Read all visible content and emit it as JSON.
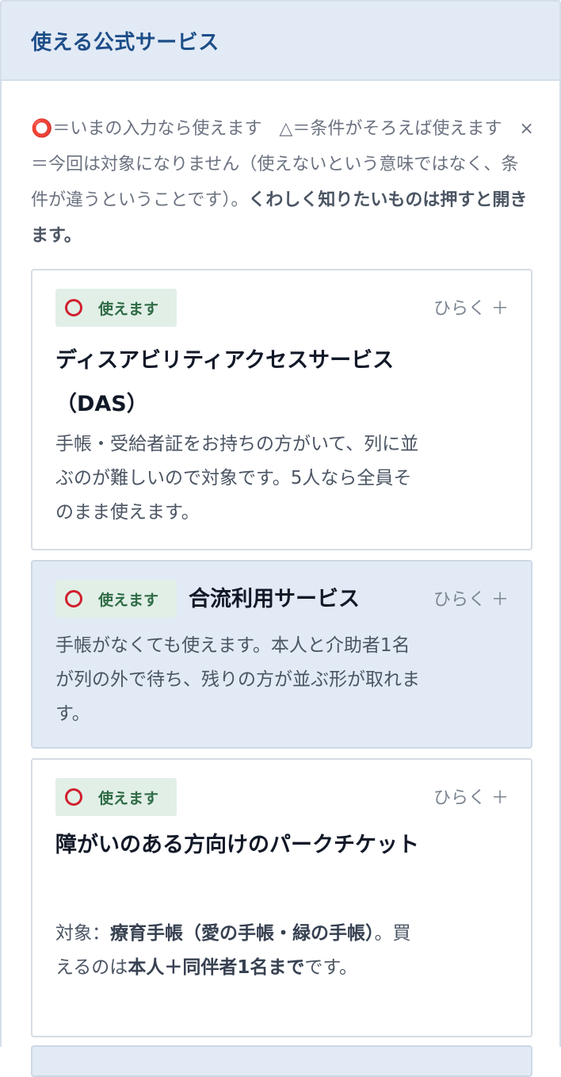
{
  "panel": {
    "title": "使える公式サービス"
  },
  "legend": {
    "ok_mark": "⭕",
    "text": "＝いまの入力なら使えます　△＝条件がそろえば使えます　×＝今回は対象になりません（使えないという意味ではなく、条件が違うということです）。",
    "bold": "くわしく知りたいものは押すと開きます。"
  },
  "cards": [
    {
      "status": "使えます",
      "status_mark": "circle-ok-icon",
      "toggle": "ひらく ＋",
      "title": "ディスアビリティアクセスサービス（DAS）",
      "body": "手帳・受給者証をお持ちの方がいて、列に並ぶのが難しいので対象です。5人なら全員そのまま使えます。"
    },
    {
      "status": "使えます",
      "status_mark": "circle-ok-icon",
      "toggle": "ひらく ＋",
      "title": "合流利用サービス",
      "body": "手帳がなくても使えます。本人と介助者1名が列の外で待ち、残りの方が並ぶ形が取れます。"
    },
    {
      "status": "使えます",
      "status_mark": "circle-ok-icon",
      "toggle": "ひらく ＋",
      "title": "障がいのある方向けのパークチケット",
      "body_prefix": "対象：",
      "body_bold1": "療育手帳（愛の手帳・緑の手帳）",
      "body_mid": "。買えるのは",
      "body_bold2": "本人＋同伴者1名まで",
      "body_suffix": "です。"
    }
  ],
  "colors": {
    "header_bg": "#e2eaf5",
    "title_blue": "#1d4e89",
    "ok_red": "#d1202e",
    "badge_bg": "#e1efe7",
    "badge_text": "#2f6b45"
  }
}
